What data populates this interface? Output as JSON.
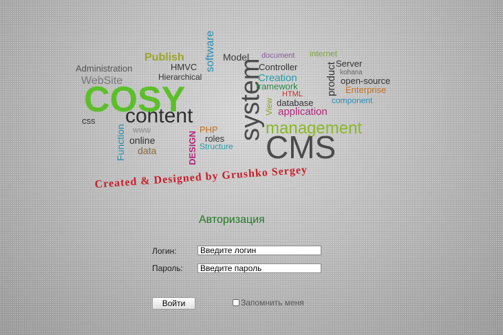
{
  "word_cloud": {
    "publish": "Publish",
    "model": "Model",
    "document": "document",
    "internet": "internet",
    "software": "software",
    "administration": "Administration",
    "hmvc": "HMVC",
    "controller": "Controller",
    "server": "Server",
    "kohana": "kohana",
    "website": "WebSite",
    "hierarchical": "Hierarchical",
    "creation": "Creation",
    "product": "product",
    "open_source": "open-source",
    "cosy": "COSY",
    "system": "system",
    "framework": "framework",
    "enterprise": "Enterprise",
    "html": "HTML",
    "database": "database",
    "component": "component",
    "view": "View",
    "application": "application",
    "css": "css",
    "content": "content",
    "function": "Function",
    "www": "www",
    "php": "PHP",
    "management": "management",
    "online": "online",
    "roles": "roles",
    "design": "DESIGN",
    "structure": "Structure",
    "cms": "CMS",
    "data": "data",
    "credits": "Created & Designed by Grushko Sergey"
  },
  "colors": {
    "green": "#5cbf2a",
    "dark": "#3a3a3a",
    "olive": "#8aa22a",
    "teal": "#2a8c9e",
    "magenta": "#b0287a",
    "red": "#c8202a",
    "orange": "#c07020",
    "title_green": "#1f7a1f"
  },
  "auth": {
    "title": "Авторизация",
    "login_label": "Логин:",
    "login_value": "Введите логин",
    "password_label": "Пароль:",
    "password_value": "Введите пароль",
    "submit_label": "Войти",
    "remember_label": "Запомнить меня",
    "remember_checked": false
  }
}
